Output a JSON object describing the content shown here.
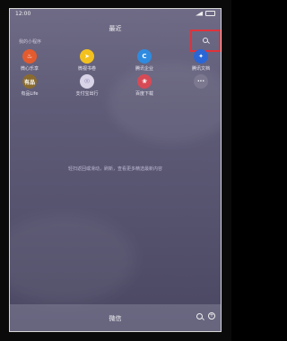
{
  "status_bar": {
    "left_text": "12:00"
  },
  "header": {
    "title": "最近"
  },
  "section": {
    "label": "我的小程序"
  },
  "apps": [
    {
      "label": "微心乐享",
      "icon": "flame-icon",
      "color": "#e35b2f"
    },
    {
      "label": "微视书卷",
      "icon": "fish-icon",
      "color": "#f3c11f"
    },
    {
      "label": "腾讯企业",
      "icon": "refresh-icon",
      "color": "#2f8be0"
    },
    {
      "label": "腾讯文档",
      "icon": "tower-icon",
      "color": "#2a66d6"
    },
    {
      "label": "有品Life",
      "icon": "youpin-icon",
      "color": "#8a6b2f",
      "glyph": "有品"
    },
    {
      "label": "支付宝出行",
      "icon": "badge-icon",
      "color": "#d9d3e8"
    },
    {
      "label": "百度下载",
      "icon": "flower-icon",
      "color": "#d64a56"
    },
    {
      "label": "",
      "icon": "more-icon",
      "color": "#7b7890"
    }
  ],
  "hint": {
    "text": "轻扫返回或滑动，刷新，查看更多精选最新内容"
  },
  "bottom": {
    "title": "微信"
  },
  "highlight": {
    "color": "#e0323a"
  }
}
